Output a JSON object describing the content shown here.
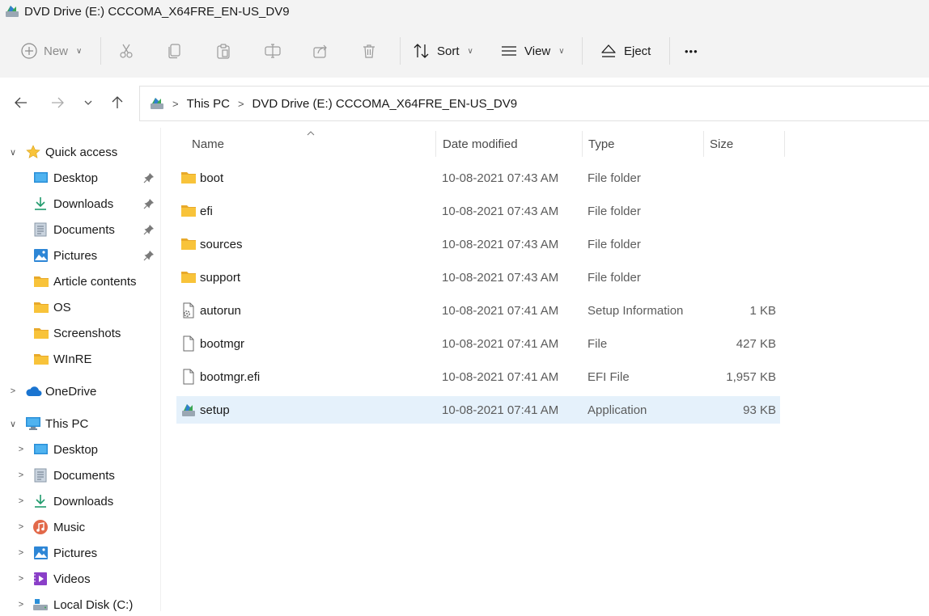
{
  "window": {
    "title": "DVD Drive (E:) CCCOMA_X64FRE_EN-US_DV9"
  },
  "toolbar": {
    "new_label": "New",
    "sort_label": "Sort",
    "view_label": "View",
    "eject_label": "Eject",
    "more_label": "•••"
  },
  "breadcrumb": {
    "items": [
      "This PC",
      "DVD Drive (E:) CCCOMA_X64FRE_EN-US_DV9"
    ]
  },
  "sidebar": {
    "quick_access": "Quick access",
    "quick_items": [
      "Desktop",
      "Downloads",
      "Documents",
      "Pictures",
      "Article contents",
      "OS",
      "Screenshots",
      "WInRE"
    ],
    "onedrive": "OneDrive",
    "this_pc": "This PC",
    "pc_items": [
      "Desktop",
      "Documents",
      "Downloads",
      "Music",
      "Pictures",
      "Videos",
      "Local Disk (C:)"
    ]
  },
  "columns": {
    "name": "Name",
    "date": "Date modified",
    "type": "Type",
    "size": "Size"
  },
  "files": [
    {
      "name": "boot",
      "date": "10-08-2021 07:43 AM",
      "type": "File folder",
      "size": "",
      "icon": "folder-icon"
    },
    {
      "name": "efi",
      "date": "10-08-2021 07:43 AM",
      "type": "File folder",
      "size": "",
      "icon": "folder-icon"
    },
    {
      "name": "sources",
      "date": "10-08-2021 07:43 AM",
      "type": "File folder",
      "size": "",
      "icon": "folder-icon"
    },
    {
      "name": "support",
      "date": "10-08-2021 07:43 AM",
      "type": "File folder",
      "size": "",
      "icon": "folder-icon"
    },
    {
      "name": "autorun",
      "date": "10-08-2021 07:41 AM",
      "type": "Setup Information",
      "size": "1 KB",
      "icon": "setup-info-icon"
    },
    {
      "name": "bootmgr",
      "date": "10-08-2021 07:41 AM",
      "type": "File",
      "size": "427 KB",
      "icon": "file-icon"
    },
    {
      "name": "bootmgr.efi",
      "date": "10-08-2021 07:41 AM",
      "type": "EFI File",
      "size": "1,957 KB",
      "icon": "file-icon"
    },
    {
      "name": "setup",
      "date": "10-08-2021 07:41 AM",
      "type": "Application",
      "size": "93 KB",
      "icon": "setup-app-icon",
      "selected": true
    }
  ],
  "colors": {
    "selection": "#e5f1fb",
    "folder": "#f8c33a",
    "accent": "#0067c0"
  }
}
